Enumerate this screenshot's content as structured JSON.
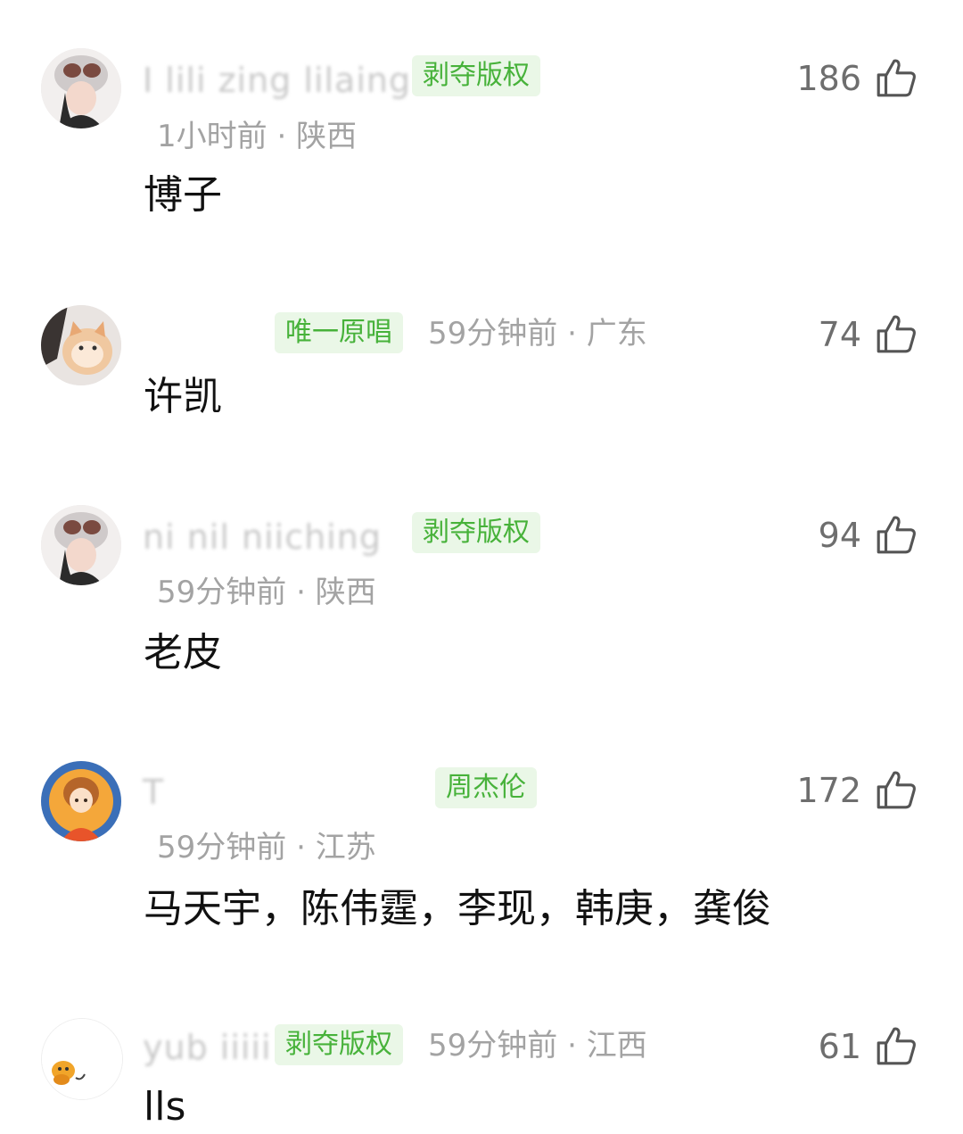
{
  "comments": [
    {
      "username": "I lili zing lilaing",
      "badge": "剥夺版权",
      "time": "1小时前",
      "location": "陕西",
      "likes": "186",
      "content": "博子",
      "avatar": "helmet-girl-avatar"
    },
    {
      "username": "",
      "badge": "唯一原唱",
      "time": "59分钟前",
      "location": "广东",
      "likes": "74",
      "content": "许凯",
      "avatar": "orange-cat-avatar"
    },
    {
      "username": "ni nil niiching",
      "badge": "剥夺版权",
      "time": "59分钟前",
      "location": "陕西",
      "likes": "94",
      "content": "老皮",
      "avatar": "helmet-girl-avatar"
    },
    {
      "username": "T",
      "badge": "周杰伦",
      "time": "59分钟前",
      "location": "江苏",
      "likes": "172",
      "content": "马天宇，陈伟霆，李现，韩庚，龚俊",
      "avatar": "anime-girl-avatar"
    },
    {
      "username": "yub iiiii",
      "badge": "剥夺版权",
      "time": "59分钟前",
      "location": "江西",
      "likes": "61",
      "content": "lls",
      "avatar": "cartoon-dog-avatar"
    }
  ],
  "separator": "·",
  "colors": {
    "badge_text": "#47b23a",
    "badge_bg": "#eaf7e7",
    "meta": "#a3a3a3",
    "likes": "#6e6e6e"
  }
}
